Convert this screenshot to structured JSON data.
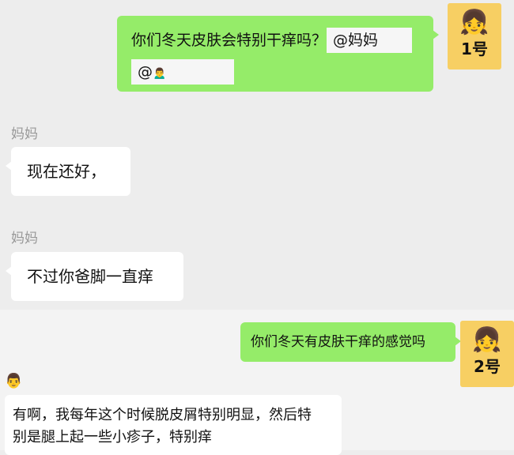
{
  "chat1": {
    "outgoing": {
      "text": "你们冬天皮肤会特别干痒吗？",
      "mention1": "@妈妈",
      "mention2_prefix": "@",
      "mention2_face": "🙍‍♂️"
    },
    "avatar": {
      "face": "👧",
      "label": "1号"
    },
    "messages": [
      {
        "sender": "妈妈",
        "text": "现在还好，"
      },
      {
        "sender": "妈妈",
        "text": "不过你爸脚一直痒"
      }
    ]
  },
  "chat2": {
    "outgoing": {
      "text": "你们冬天有皮肤干痒的感觉吗"
    },
    "avatar": {
      "face": "👧",
      "label": "2号"
    },
    "incoming": {
      "sender_face": "👨",
      "line1": "有啊，我每年这个时候脱皮屑特别明显，然后特",
      "line2": "别是腿上起一些小疹子，特别痒"
    }
  }
}
